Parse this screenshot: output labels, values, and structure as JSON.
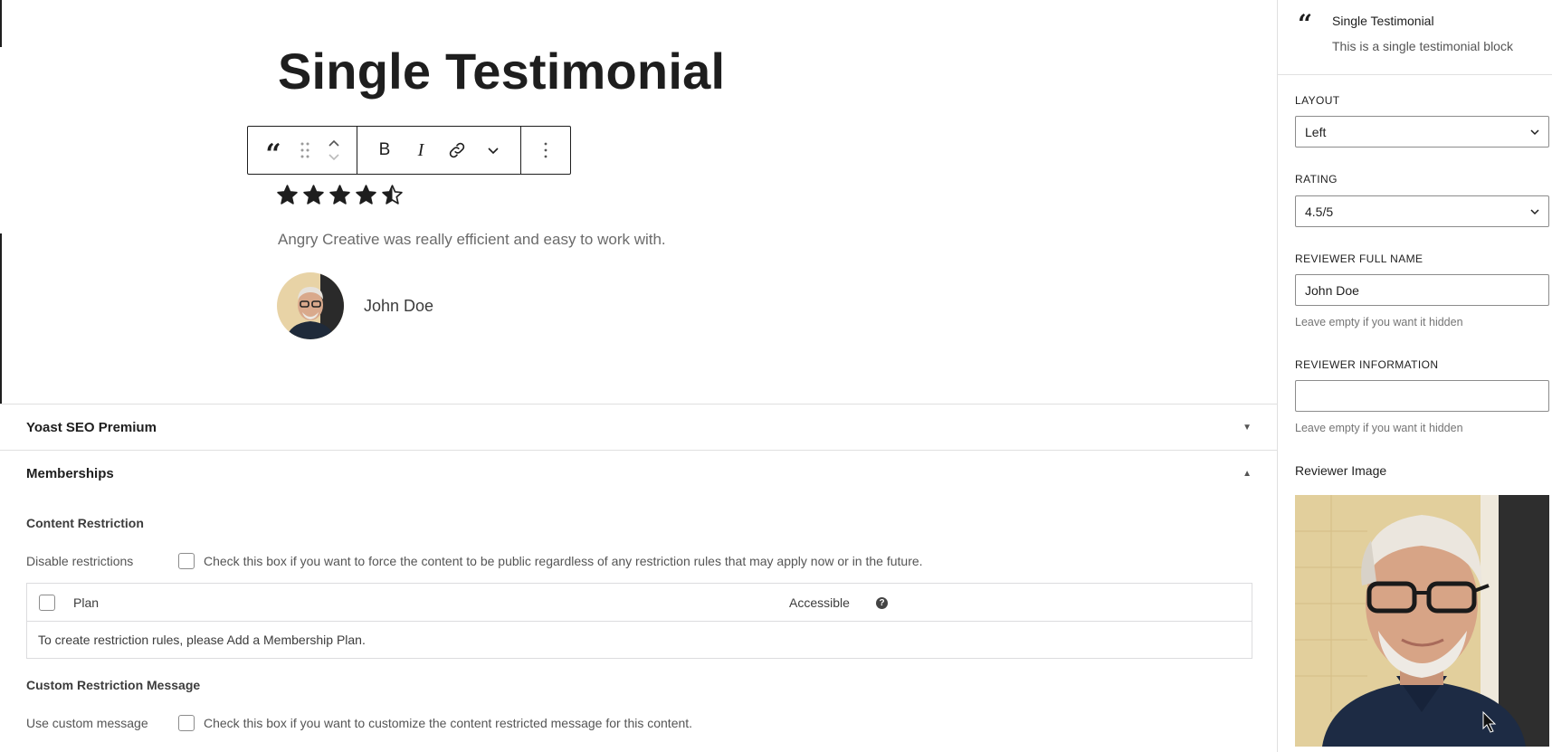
{
  "block": {
    "title": "Single Testimonial",
    "rating": 4.5,
    "text": "Angry Creative was really efficient and easy to work with.",
    "reviewer_name": "John Doe"
  },
  "toolbar": {
    "block_icon": "quote-icon",
    "drag_icon": "drag-handle-icon",
    "move_icon": "move-up-down-icon",
    "bold": "B",
    "italic": "I",
    "link_icon": "link-icon",
    "more_rich_icon": "chevron-down-icon",
    "options_icon": "more-vertical-icon"
  },
  "metaboxes": {
    "yoast": {
      "title": "Yoast SEO Premium",
      "collapsed": true
    },
    "memberships": {
      "title": "Memberships",
      "content_restriction": {
        "title": "Content Restriction",
        "disable_label": "Disable restrictions",
        "disable_desc": "Check this box if you want to force the content to be public regardless of any restriction rules that may apply now or in the future.",
        "table": {
          "col_plan": "Plan",
          "col_accessible": "Accessible",
          "empty_text": "To create restriction rules, please ",
          "empty_link": "Add a Membership Plan",
          "empty_suffix": "."
        }
      },
      "custom_message": {
        "title": "Custom Restriction Message",
        "label": "Use custom message",
        "desc": "Check this box if you want to customize the content restricted message for this content."
      }
    }
  },
  "sidebar": {
    "block_title": "Single Testimonial",
    "block_desc": "This is a single testimonial block",
    "layout": {
      "label": "Layout",
      "value": "Left"
    },
    "rating": {
      "label": "Rating",
      "value": "4.5/5"
    },
    "reviewer_full_name": {
      "label": "Reviewer Full Name",
      "value": "John Doe",
      "help": "Leave empty if you want it hidden"
    },
    "reviewer_information": {
      "label": "Reviewer Information",
      "value": "",
      "help": "Leave empty if you want it hidden"
    },
    "reviewer_image": {
      "label": "Reviewer Image"
    }
  },
  "colors": {
    "link": "#2271b1",
    "text": "#1e1e1e",
    "muted": "#757575",
    "border": "#e0e0e0"
  }
}
